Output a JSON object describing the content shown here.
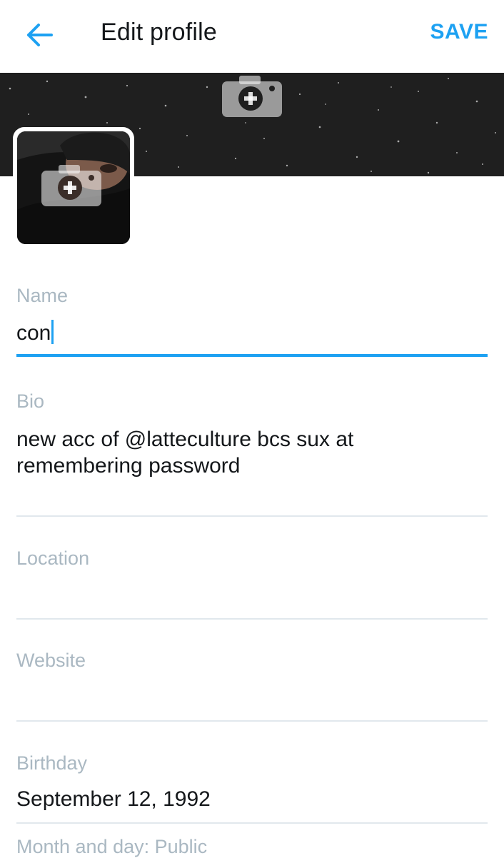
{
  "header": {
    "title": "Edit profile",
    "save_label": "SAVE",
    "back_icon": "arrow-left-icon"
  },
  "banner": {
    "camera_icon": "add-photo-camera-icon"
  },
  "avatar": {
    "camera_icon": "add-photo-camera-icon"
  },
  "form": {
    "name": {
      "label": "Name",
      "value": "con"
    },
    "bio": {
      "label": "Bio",
      "value_line1": "new acc of @latteculture bcs sux at",
      "value_line2": "remembering password"
    },
    "location": {
      "label": "Location",
      "value": ""
    },
    "website": {
      "label": "Website",
      "value": ""
    },
    "birthday": {
      "label": "Birthday",
      "value": "September 12, 1992"
    },
    "visibility_note": "Month and day: Public"
  },
  "colors": {
    "accent": "#1da1f2",
    "label": "#aab8c2",
    "text": "#14171a",
    "divider": "#e1e8ed"
  }
}
